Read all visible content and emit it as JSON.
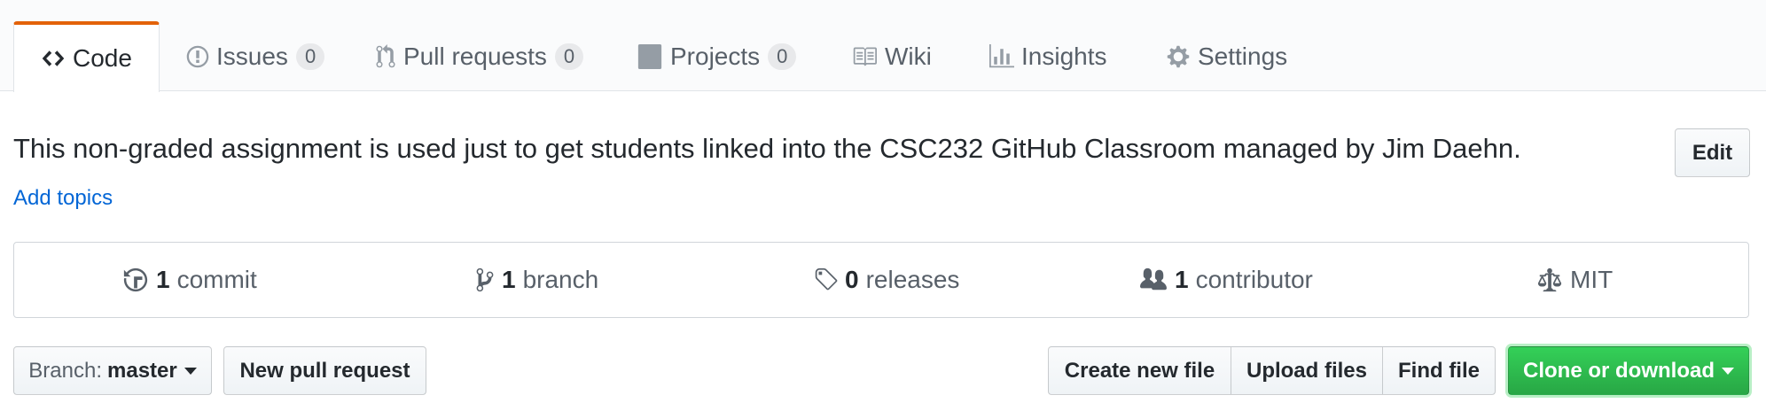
{
  "tabs": [
    {
      "label": "Code",
      "icon": "code-icon",
      "selected": true
    },
    {
      "label": "Issues",
      "icon": "issue-opened-icon",
      "count": "0"
    },
    {
      "label": "Pull requests",
      "icon": "git-pull-request-icon",
      "count": "0"
    },
    {
      "label": "Projects",
      "icon": "project-icon",
      "count": "0"
    },
    {
      "label": "Wiki",
      "icon": "book-icon"
    },
    {
      "label": "Insights",
      "icon": "graph-icon"
    },
    {
      "label": "Settings",
      "icon": "gear-icon"
    }
  ],
  "repo": {
    "description": "This non-graded assignment is used just to get students linked into the CSC232 GitHub Classroom managed by Jim Daehn.",
    "edit_label": "Edit",
    "add_topics": "Add topics"
  },
  "summary": {
    "commits": {
      "count": "1",
      "label": "commit",
      "icon": "history-icon"
    },
    "branches": {
      "count": "1",
      "label": "branch",
      "icon": "git-branch-icon"
    },
    "releases": {
      "count": "0",
      "label": "releases",
      "icon": "tag-icon"
    },
    "contributors": {
      "count": "1",
      "label": "contributor",
      "icon": "organization-icon"
    },
    "license": {
      "label": "MIT",
      "icon": "law-icon"
    }
  },
  "toolbar": {
    "branch_prefix": "Branch:",
    "branch_name": "master",
    "new_pr": "New pull request",
    "create_file": "Create new file",
    "upload_files": "Upload files",
    "find_file": "Find file",
    "clone": "Clone or download"
  },
  "colors": {
    "accent": "#e36209",
    "link": "#0366d6",
    "primary_button": "#28a745"
  }
}
